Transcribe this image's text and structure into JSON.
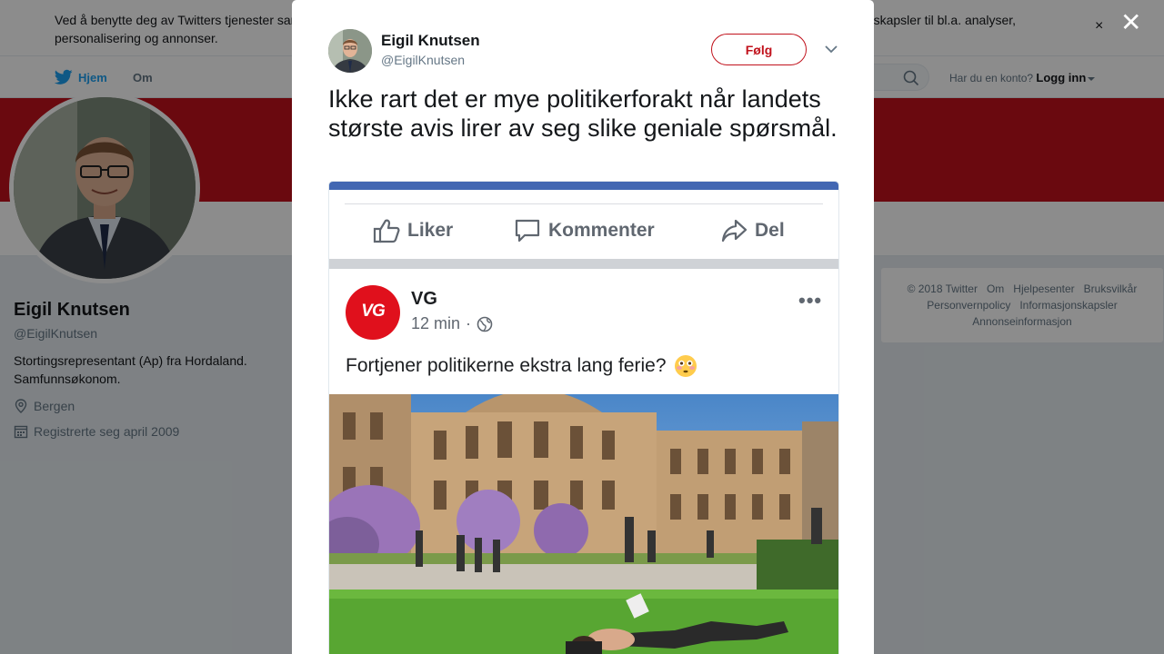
{
  "cookie_bar": {
    "text": "Ved å benytte deg av Twitters tjenester samtykker du til bruken av informasjonskapsler. Twitter og partnere opererer globalt og bruker informasjonskapsler til bl.a. analyser, personalisering og annonser.",
    "close": "×"
  },
  "nav": {
    "home": "Hjem",
    "about": "Om",
    "login_prompt": "Har du en konto?",
    "login": "Logg inn"
  },
  "profile": {
    "name": "Eigil Knutsen",
    "handle": "@EigilKnutsen",
    "bio": "Stortingsrepresentant (Ap) fra Hordaland. Samfunnsøkonom.",
    "location": "Bergen",
    "joined": "Registrerte seg april 2009"
  },
  "footer": {
    "copyright": "© 2018 Twitter",
    "about": "Om",
    "help": "Hjelpesenter",
    "terms": "Bruksvilkår",
    "privacy": "Personvernpolicy",
    "cookies": "Informasjonskapsler",
    "ads": "Annonseinformasjon"
  },
  "overlay": {
    "close": "✕"
  },
  "tweet": {
    "author_name": "Eigil Knutsen",
    "author_handle": "@EigilKnutsen",
    "follow_label": "Følg",
    "text": "Ikke rart det er mye politikerforakt når landets største avis lirer av seg slike geniale spørsmål."
  },
  "embedded_post": {
    "actions": {
      "like": "Liker",
      "comment": "Kommenter",
      "share": "Del"
    },
    "page_name": "VG",
    "logo_text": "VG",
    "time": "12 min",
    "dot": "·",
    "more": "•••",
    "post_text": "Fortjener politikerne ekstra lang ferie?"
  },
  "colors": {
    "brand": "#c1121c",
    "twitter_blue": "#1da1f2",
    "facebook_blue": "#4267b2",
    "vg_red": "#e0101c"
  }
}
